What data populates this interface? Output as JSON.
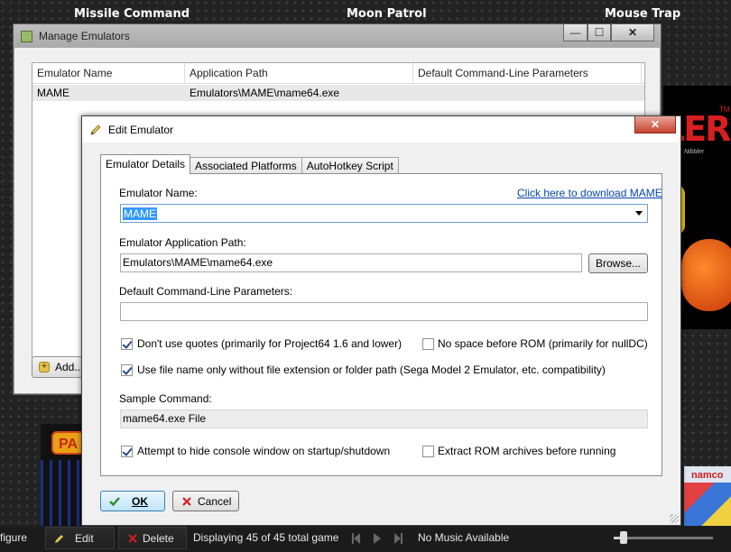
{
  "background": {
    "game_titles": [
      "Missile Command",
      "Moon Patrol",
      "Mouse Trap"
    ],
    "art_text": {
      "logo": "LER",
      "tm": "TM",
      "nibbler": "Nibbler",
      "pa": "PA",
      "namco": "namco"
    }
  },
  "manage_window": {
    "title": "Manage Emulators",
    "columns": [
      "Emulator Name",
      "Application Path",
      "Default Command-Line Parameters"
    ],
    "rows": [
      {
        "name": "MAME",
        "path": "Emulators\\MAME\\mame64.exe",
        "params": ""
      }
    ],
    "add_button": "Add..."
  },
  "edit_dialog": {
    "title": "Edit Emulator",
    "tabs": [
      "Emulator Details",
      "Associated Platforms",
      "AutoHotkey Script"
    ],
    "emulator_name_label": "Emulator Name:",
    "download_link": "Click here to download MAME",
    "emulator_name_value": "MAME",
    "app_path_label": "Emulator Application Path:",
    "app_path_value": "Emulators\\MAME\\mame64.exe",
    "browse_button": "Browse...",
    "params_label": "Default Command-Line Parameters:",
    "params_value": "",
    "checkbox_no_quotes": {
      "label": "Don't use quotes (primarily for Project64 1.6 and lower)",
      "checked": true
    },
    "checkbox_no_space": {
      "label": "No space before ROM (primarily for nullDC)",
      "checked": false
    },
    "checkbox_filename_only": {
      "label": "Use file name only without file extension or folder path (Sega Model 2 Emulator, etc. compatibility)",
      "checked": true
    },
    "sample_command_label": "Sample Command:",
    "sample_command_value": "mame64.exe File",
    "checkbox_hide_console": {
      "label": "Attempt to hide console window on startup/shutdown",
      "checked": true
    },
    "checkbox_extract": {
      "label": "Extract ROM archives before running",
      "checked": false
    },
    "ok_button": "OK",
    "cancel_button": "Cancel"
  },
  "bottom_bar": {
    "configure": "figure",
    "edit": "Edit",
    "delete": "Delete",
    "status": "Displaying 45 of 45 total game",
    "music": "No Music Available"
  }
}
